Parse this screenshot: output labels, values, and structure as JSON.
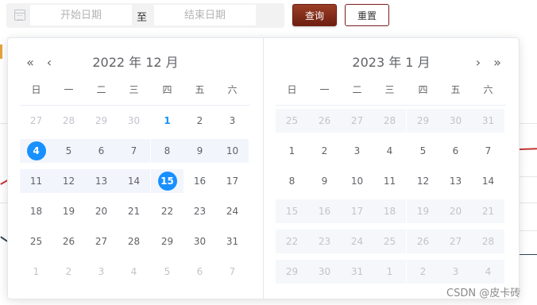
{
  "toolbar": {
    "start_placeholder": "开始日期",
    "end_placeholder": "结束日期",
    "range_separator": "至",
    "query_label": "查询",
    "reset_label": "重置"
  },
  "picker": {
    "weekdays": [
      "日",
      "一",
      "二",
      "三",
      "四",
      "五",
      "六"
    ],
    "left": {
      "title": "2022 年 12 月",
      "prev_year": "«",
      "prev_month": "‹",
      "rows": [
        [
          "27",
          "28",
          "29",
          "30",
          "1",
          "2",
          "3"
        ],
        [
          "4",
          "5",
          "6",
          "7",
          "8",
          "9",
          "10"
        ],
        [
          "11",
          "12",
          "13",
          "14",
          "15",
          "16",
          "17"
        ],
        [
          "18",
          "19",
          "20",
          "21",
          "22",
          "23",
          "24"
        ],
        [
          "25",
          "26",
          "27",
          "28",
          "29",
          "30",
          "31"
        ],
        [
          "1",
          "2",
          "3",
          "4",
          "5",
          "6",
          "7"
        ]
      ]
    },
    "right": {
      "title": "2023 年 1 月",
      "next_month": "›",
      "next_year": "»",
      "rows": [
        [
          "25",
          "26",
          "27",
          "28",
          "29",
          "30",
          "31"
        ],
        [
          "1",
          "2",
          "3",
          "4",
          "5",
          "6",
          "7"
        ],
        [
          "8",
          "9",
          "10",
          "11",
          "12",
          "13",
          "14"
        ],
        [
          "15",
          "16",
          "17",
          "18",
          "19",
          "20",
          "21"
        ],
        [
          "22",
          "23",
          "24",
          "25",
          "26",
          "27",
          "28"
        ],
        [
          "29",
          "30",
          "31",
          "1",
          "2",
          "3",
          "4"
        ]
      ]
    },
    "range_start": "2022-12-04",
    "range_end": "2022-12-15",
    "today": "2022-12-01",
    "accent_color": "#1890ff"
  },
  "watermark": "CSDN @皮卡砖"
}
